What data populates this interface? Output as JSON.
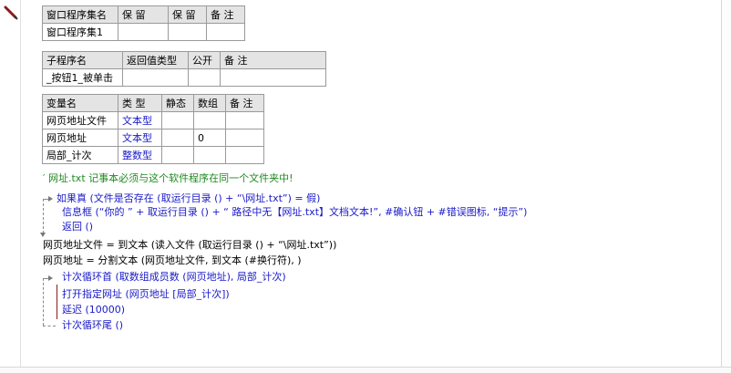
{
  "table_program_set": {
    "headers": [
      "窗口程序集名",
      "保 留",
      "保 留",
      "备 注"
    ],
    "name": "窗口程序集1"
  },
  "table_subroutine": {
    "headers": [
      "子程序名",
      "返回值类型",
      "公开",
      "备 注"
    ],
    "name": "_按钮1_被单击"
  },
  "table_variables": {
    "headers": [
      "变量名",
      "类 型",
      "静态",
      "数组",
      "备 注"
    ],
    "rows": [
      {
        "name": "网页地址文件",
        "type": "文本型",
        "array": ""
      },
      {
        "name": "网页地址",
        "type": "文本型",
        "array": "0"
      },
      {
        "name": "局部_计次",
        "type": "整数型",
        "array": ""
      }
    ]
  },
  "code": {
    "comment": "′ 网址.txt 记事本必须与这个软件程序在同一个文件夹中!",
    "line_if": "如果真 (文件是否存在 (取运行目录 () + “\\网址.txt”) = 假)",
    "line_msgbox": "信息框 (“你的 ” + 取运行目录 () + “ 路径中无【网址.txt】文档文本!”, #确认钮 + #错误图标, “提示”)",
    "line_return": "返回 ()",
    "line_read": "网页地址文件 = 到文本 (读入文件 (取运行目录 () + “\\网址.txt”))",
    "line_split": "网页地址 = 分割文本 (网页地址文件, 到文本 (#换行符), )",
    "line_loop": "计次循环首 (取数组成员数 (网页地址), 局部_计次)",
    "line_open": "打开指定网址 (网页地址 [局部_计次])",
    "line_delay": "延迟 (10000)",
    "line_loop_end": "计次循环尾 ()"
  }
}
